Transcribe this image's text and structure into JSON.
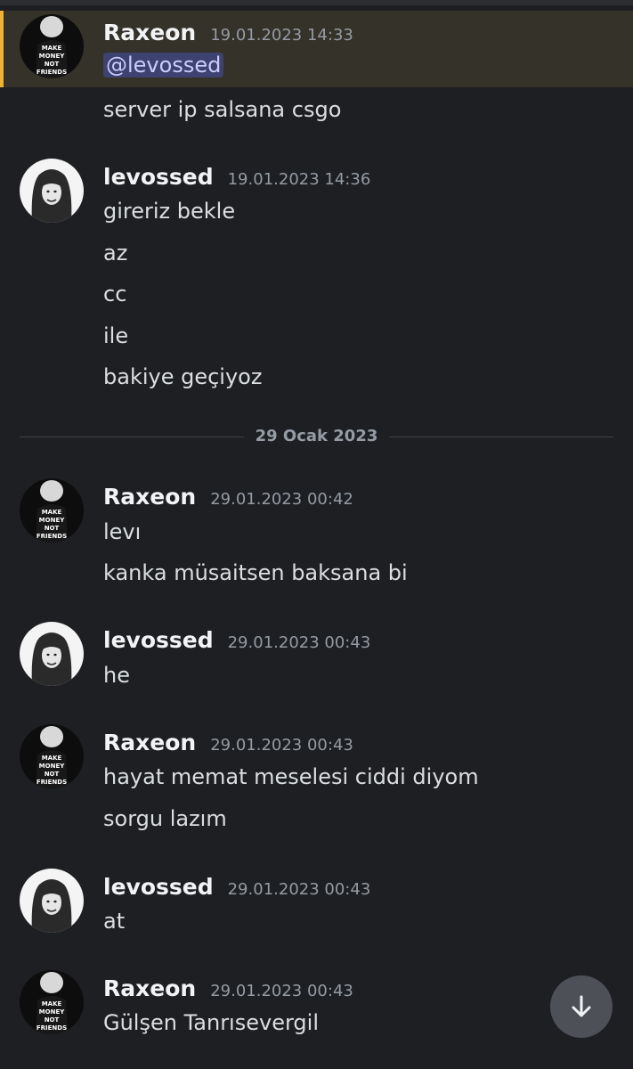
{
  "messages": {
    "m1": {
      "username": "Raxeon",
      "timestamp": "19.01.2023 14:33",
      "mention": "@levossed",
      "lines": [
        "server ip salsana csgo"
      ]
    },
    "m2": {
      "username": "levossed",
      "timestamp": "19.01.2023 14:36",
      "lines": [
        "gireriz bekle",
        "az",
        "cc",
        "ile",
        "bakiye geçiyoz"
      ]
    },
    "m3": {
      "username": "Raxeon",
      "timestamp": "29.01.2023 00:42",
      "lines": [
        "levı",
        "kanka müsaitsen baksana bi"
      ]
    },
    "m4": {
      "username": "levossed",
      "timestamp": "29.01.2023 00:43",
      "lines": [
        "he"
      ]
    },
    "m5": {
      "username": "Raxeon",
      "timestamp": "29.01.2023 00:43",
      "lines": [
        "hayat memat meselesi ciddi diyom",
        "sorgu lazım"
      ]
    },
    "m6": {
      "username": "levossed",
      "timestamp": "29.01.2023 00:43",
      "lines": [
        "at"
      ]
    },
    "m7": {
      "username": "Raxeon",
      "timestamp": "29.01.2023 00:43",
      "lines": [
        "Gülşen Tanrısevergil"
      ]
    }
  },
  "date_divider": {
    "label": "29 Ocak 2023"
  },
  "avatar_text": {
    "raxeon": [
      "MAKE",
      "MONEY",
      "NOT",
      "FRIENDS"
    ]
  },
  "icons": {
    "scroll_down": "arrow-down-icon"
  },
  "colors": {
    "background": "#1e1f22",
    "mention_highlight": "#35322a",
    "mention_bar": "#f0b232",
    "mention_pill": "#3d4270",
    "username": "#f2f3f5",
    "timestamp": "#949ba4"
  }
}
